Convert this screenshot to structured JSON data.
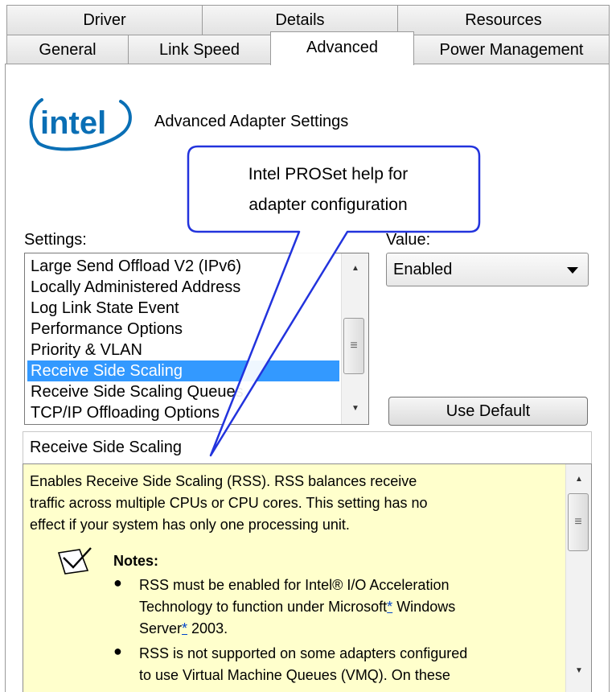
{
  "tabs": {
    "row1": [
      "Driver",
      "Details",
      "Resources"
    ],
    "row2": [
      "General",
      "Link Speed",
      "Advanced",
      "Power Management"
    ]
  },
  "header": {
    "logo_text": "intel",
    "title": "Advanced Adapter Settings"
  },
  "callout": {
    "line1": "Intel PROSet help for",
    "line2": "adapter configuration"
  },
  "settings": {
    "label": "Settings:",
    "items": [
      "Large Send Offload V2 (IPv6)",
      "Locally Administered Address",
      "Log Link State Event",
      "Performance Options",
      "Priority & VLAN",
      "Receive Side Scaling",
      "Receive Side Scaling Queues",
      "TCP/IP Offloading Options"
    ],
    "selected": "Receive Side Scaling"
  },
  "value": {
    "label": "Value:",
    "selected": "Enabled"
  },
  "use_default_label": "Use Default",
  "help": {
    "title": "Receive Side Scaling",
    "paragraph_lines": [
      "Enables Receive Side Scaling (RSS). RSS balances receive",
      "traffic across multiple CPUs or CPU cores. This setting has no",
      "effect if your system has only one processing unit."
    ],
    "notes_heading": "Notes:",
    "note1_line1": "RSS must be enabled for Intel® I/O Acceleration",
    "note1_line2_pre": "Technology to function under Microsoft",
    "note1_line2_link": "*",
    "note1_line2_post": " Windows",
    "note1_line3_pre": "Server",
    "note1_line3_link": "*",
    "note1_line3_post": " 2003.",
    "note2_line1": "RSS is not supported on some adapters configured",
    "note2_line2": "to use Virtual Machine Queues (VMQ). On these"
  },
  "colors": {
    "selection": "#3399ff",
    "help_background": "#ffffcc",
    "callout_border": "#2233dd",
    "intel_blue": "#0a6fb5"
  }
}
